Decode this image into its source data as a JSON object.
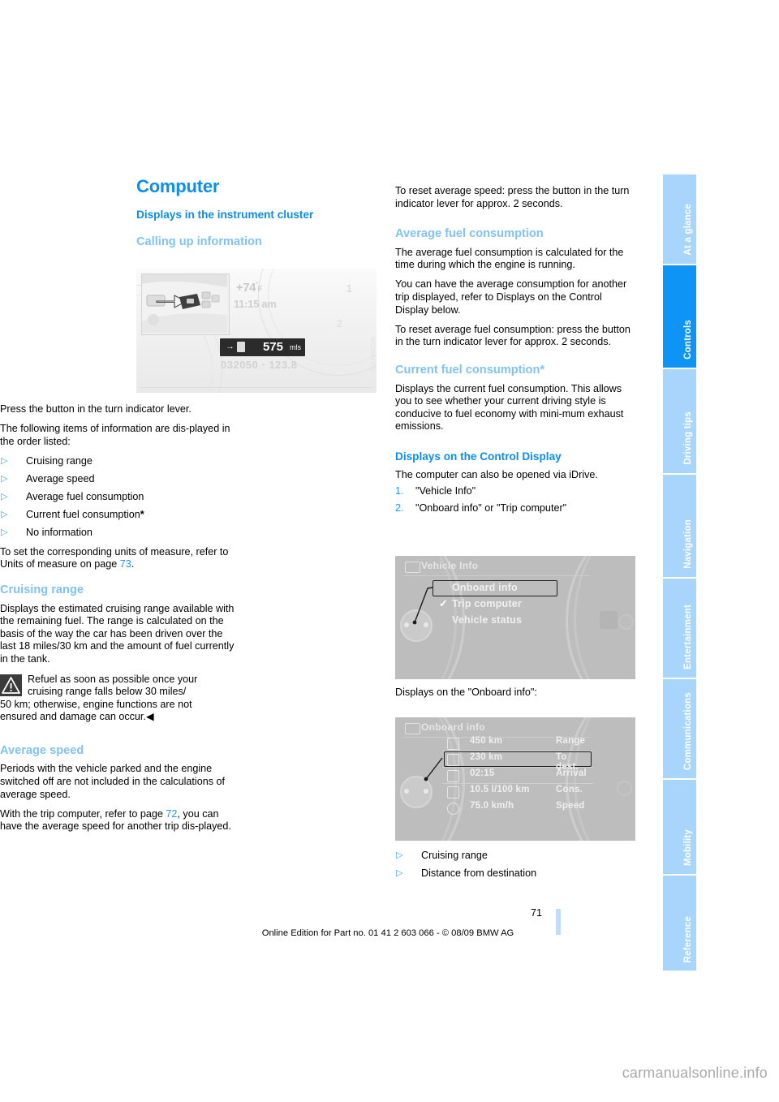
{
  "document": {
    "title": "Computer",
    "subtitle": "Displays in the instrument cluster"
  },
  "left_column": {
    "section_calling": {
      "heading": "Calling up information",
      "para_1": "Press the button in the turn indicator lever.",
      "para_2": "The following items of information are dis-played in the order listed:",
      "bullets": [
        "Cruising range",
        "Average speed",
        "Average fuel consumption",
        "Current fuel consumption",
        "No information"
      ],
      "bullet_4_marker": "*",
      "para_3_pre": "To set the corresponding units of measure, refer to Units of measure on page ",
      "para_3_link": "73",
      "para_3_post": "."
    },
    "section_cruising": {
      "heading": "Cruising range",
      "para_1": "Displays the estimated cruising range available with the remaining fuel. The range is calculated on the basis of the way the car has been driven over the last 18 miles/30 km and the amount of fuel currently in the tank.",
      "warning_line_1": "Refuel as soon as possible once your",
      "warning_line_2": "cruising range falls below 30 miles/",
      "warning_line_3": "50 km; otherwise, engine functions are not",
      "warning_line_4": "ensured and damage can occur.",
      "warning_end_mark": "◀"
    },
    "section_avgspeed": {
      "heading": "Average speed",
      "para_1": "Periods with the vehicle parked and the engine switched off are not included in the calculations of average speed.",
      "para_2_pre": "With the trip computer, refer to page ",
      "para_2_link": "72",
      "para_2_post": ", you can have the average speed for another trip dis-played."
    }
  },
  "right_column": {
    "para_reset_speed": "To reset average speed: press the button in the turn indicator lever for approx. 2 seconds.",
    "section_avgfuel": {
      "heading": "Average fuel consumption",
      "para_1": "The average fuel consumption is calculated for the time during which the engine is running.",
      "para_2": "You can have the average consumption for another trip displayed, refer to Displays on the Control Display below.",
      "para_3": "To reset average fuel consumption: press the button in the turn indicator lever for approx. 2 seconds."
    },
    "section_currentfuel": {
      "heading": "Current fuel consumption*",
      "para_1": "Displays the current fuel consumption. This allows you to see whether your current driving style is conducive to fuel economy with mini-mum exhaust emissions."
    },
    "section_controldisplay": {
      "heading": "Displays on the Control Display",
      "para_1": "The computer can also be opened via iDrive.",
      "steps": [
        {
          "num": "1.",
          "text": "\"Vehicle Info\""
        },
        {
          "num": "2.",
          "text": "\"Onboard info\" or \"Trip computer\""
        }
      ],
      "caption_onboard": "Displays on the \"Onboard info\":",
      "bullets": [
        "Cruising range",
        "Distance from destination"
      ]
    }
  },
  "figure_cluster": {
    "temperature": "74",
    "temperature_sign": "+",
    "temperature_unit": "F",
    "temperature_degree": "°",
    "clock": "11:15 am",
    "range_value": "575",
    "range_unit": "mls",
    "range_arrow": "→",
    "odometer": "032050 · 123.8",
    "tach_label_1": "1",
    "tach_label_2": "2",
    "watermark": "WC0304030"
  },
  "figure_vehicle_info": {
    "header": "Vehicle Info",
    "items": [
      {
        "label": "Onboard info",
        "selected": true,
        "checked": false
      },
      {
        "label": "Trip computer",
        "selected": false,
        "checked": true
      },
      {
        "label": "Vehicle status",
        "selected": false,
        "checked": false
      }
    ],
    "check_glyph": "✓"
  },
  "figure_onboard_info": {
    "header": "Onboard info",
    "rows": [
      {
        "value": "450  km",
        "label": "Range",
        "highlighted": false
      },
      {
        "value": "230  km",
        "label": "To dest.",
        "highlighted": true
      },
      {
        "value": "02:15",
        "label": "Arrival",
        "highlighted": false
      },
      {
        "value": "10.5 l/100 km",
        "label": "Cons.",
        "highlighted": false
      },
      {
        "value": "75.0 km/h",
        "label": "Speed",
        "highlighted": false
      }
    ]
  },
  "footer": {
    "page_number": "71",
    "edition_line": "Online Edition for Part no. 01 41 2 603 066 - © 08/09 BMW AG"
  },
  "sidebar": {
    "tabs": [
      {
        "label": "At a glance",
        "active": false
      },
      {
        "label": "Controls",
        "active": true
      },
      {
        "label": "Driving tips",
        "active": false
      },
      {
        "label": "Navigation",
        "active": false
      },
      {
        "label": "Entertainment",
        "active": false
      },
      {
        "label": "Communications",
        "active": false
      },
      {
        "label": "Mobility",
        "active": false
      },
      {
        "label": "Reference",
        "active": false
      }
    ]
  },
  "watermark": {
    "site": "carmanualsonline.info"
  },
  "colors": {
    "accent_blue": "#0a8ef0",
    "light_blue": "#7fc3f5",
    "tab_inactive": "#a8d5fb",
    "tab_active": "#0d94f5",
    "link": "#2196f3"
  }
}
